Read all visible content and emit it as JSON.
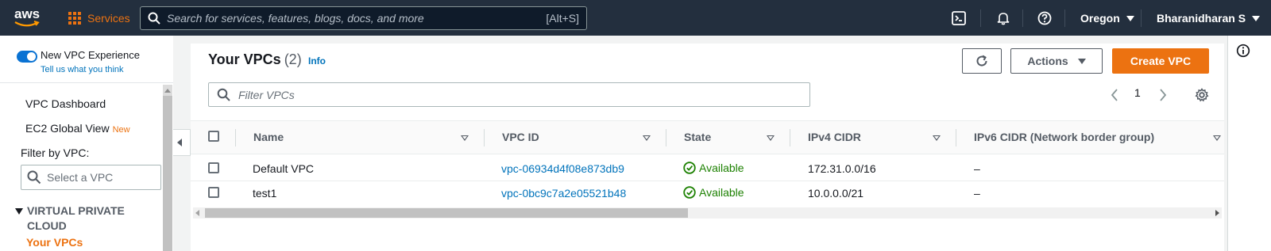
{
  "colors": {
    "topbar": "#232f3e",
    "accent": "#ec7211",
    "link": "#0073bb",
    "available": "#1d8102"
  },
  "topbar": {
    "logo": "aws",
    "services_label": "Services",
    "search_placeholder": "Search for services, features, blogs, docs, and more",
    "search_shortcut": "[Alt+S]",
    "icons": [
      "cloudshell-icon",
      "bell-icon",
      "help-icon"
    ],
    "region": "Oregon",
    "user": "Bharanidharan S"
  },
  "sidebar": {
    "new_experience": "New VPC Experience",
    "tell_us": "Tell us what you think",
    "links": [
      {
        "label": "VPC Dashboard"
      },
      {
        "label": "EC2 Global View",
        "tag": "New"
      }
    ],
    "filter_label": "Filter by VPC:",
    "select_placeholder": "Select a VPC",
    "section_title": "VIRTUAL PRIVATE CLOUD",
    "active_item": "Your VPCs"
  },
  "main": {
    "title": "Your VPCs",
    "count": "(2)",
    "info": "Info",
    "actions_label": "Actions",
    "create_label": "Create VPC",
    "filter_placeholder": "Filter VPCs",
    "page": "1",
    "columns": [
      "Name",
      "VPC ID",
      "State",
      "IPv4 CIDR",
      "IPv6 CIDR (Network border group)"
    ],
    "rows": [
      {
        "name": "Default VPC",
        "vpc_id": "vpc-06934d4f08e873db9",
        "state": "Available",
        "ipv4": "172.31.0.0/16",
        "ipv6": "–"
      },
      {
        "name": "test1",
        "vpc_id": "vpc-0bc9c7a2e05521b48",
        "state": "Available",
        "ipv4": "10.0.0.0/21",
        "ipv6": "–"
      }
    ]
  }
}
